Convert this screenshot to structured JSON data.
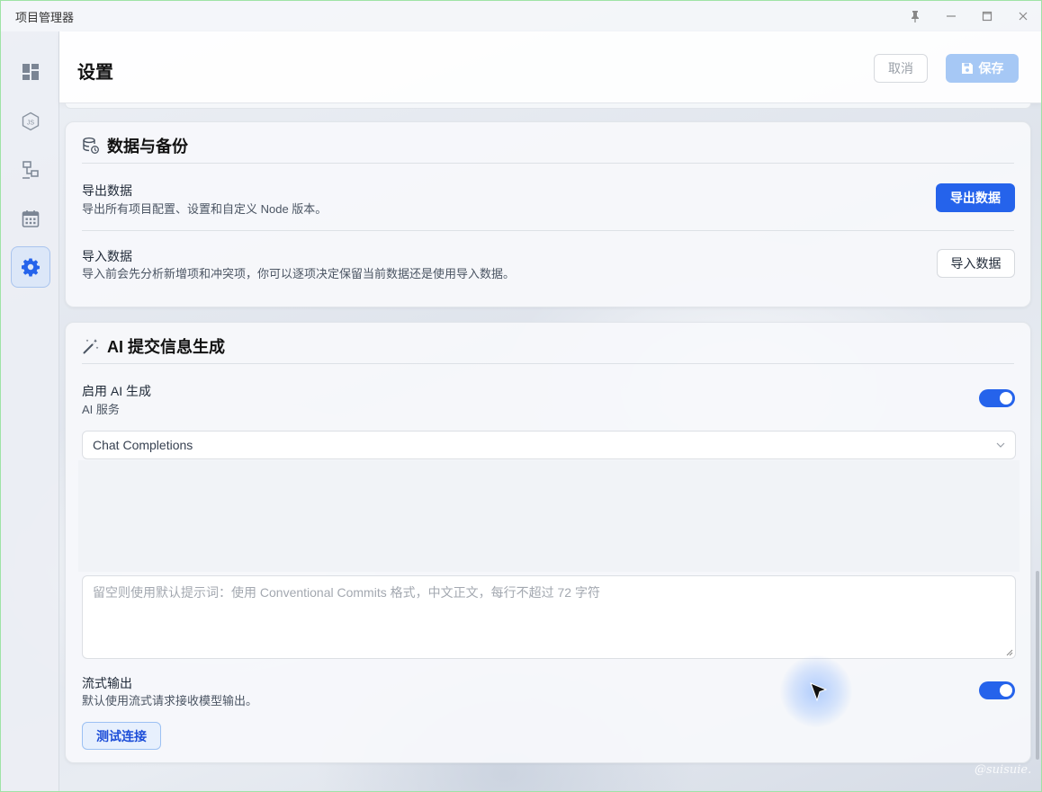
{
  "window": {
    "title": "项目管理器",
    "controls": [
      "pin-icon",
      "minimize-icon",
      "maximize-icon",
      "close-icon"
    ]
  },
  "sidebar": {
    "items": [
      {
        "name": "dashboard",
        "icon": "dashboard-icon",
        "active": false
      },
      {
        "name": "node",
        "icon": "nodejs-icon",
        "active": false
      },
      {
        "name": "remote",
        "icon": "device-tree-icon",
        "active": false
      },
      {
        "name": "calendar",
        "icon": "calendar-icon",
        "active": false
      },
      {
        "name": "settings",
        "icon": "gear-icon",
        "active": true
      }
    ]
  },
  "header": {
    "title": "设置",
    "cancel_label": "取消",
    "save_label": "保存"
  },
  "data_section": {
    "title": "数据与备份",
    "icon": "database-sync-icon",
    "export": {
      "label": "导出数据",
      "description": "导出所有项目配置、设置和自定义 Node 版本。",
      "button": "导出数据"
    },
    "import": {
      "label": "导入数据",
      "description": "导入前会先分析新增项和冲突项，你可以逐项决定保留当前数据还是使用导入数据。",
      "button": "导入数据"
    }
  },
  "ai_section": {
    "title": "AI 提交信息生成",
    "icon": "magic-wand-icon",
    "enable": {
      "label": "启用 AI 生成",
      "description": "AI 服务",
      "enabled": true
    },
    "service_select": {
      "value": "Chat Completions"
    },
    "prompt": {
      "placeholder": "留空则使用默认提示词：使用 Conventional Commits 格式，中文正文，每行不超过 72 字符",
      "value": ""
    },
    "stream": {
      "label": "流式输出",
      "description": "默认使用流式请求接收模型输出。",
      "enabled": true
    },
    "test_button": "测试连接"
  },
  "colors": {
    "primary": "#2563eb",
    "save_disabled": "#a6c8f5",
    "active_nav_bg": "#dce7f8"
  },
  "watermark": "@suisuie."
}
